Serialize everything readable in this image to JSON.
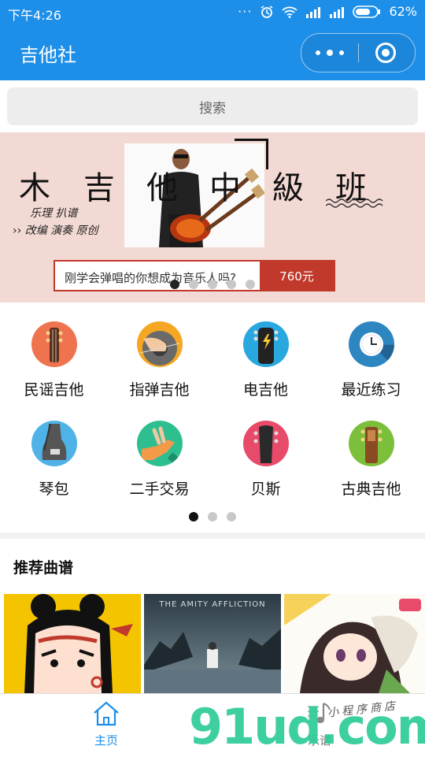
{
  "statusbar": {
    "time": "下午4:26",
    "battery": "62%"
  },
  "navbar": {
    "title": "吉他社"
  },
  "search": {
    "placeholder": "搜索"
  },
  "banner": {
    "chars": [
      "木",
      "吉",
      "他",
      "中",
      "級",
      "班"
    ],
    "sub1": "乐理  扒谱",
    "sub2": "改编  演奏  原创",
    "cta": "刚学会弹唱的你想成为音乐人吗?",
    "price": "760元",
    "dots": 5,
    "active_dot": 0
  },
  "categories": [
    {
      "label": "民谣吉他",
      "icon": "folk-guitar-icon",
      "color": "#f0734f"
    },
    {
      "label": "指弹吉他",
      "icon": "fingerstyle-guitar-icon",
      "color": "#f5a623"
    },
    {
      "label": "电吉他",
      "icon": "electric-guitar-icon",
      "color": "#29a8e0"
    },
    {
      "label": "最近练习",
      "icon": "clock-icon",
      "color": "#2e86c1"
    },
    {
      "label": "琴包",
      "icon": "guitar-bag-icon",
      "color": "#4fb3e8"
    },
    {
      "label": "二手交易",
      "icon": "trade-hand-icon",
      "color": "#2ebf91"
    },
    {
      "label": "贝斯",
      "icon": "bass-icon",
      "color": "#e84a6a"
    },
    {
      "label": "古典吉他",
      "icon": "classical-guitar-icon",
      "color": "#7cbf3a"
    }
  ],
  "category_pages": {
    "count": 3,
    "active": 0
  },
  "recommend": {
    "title": "推荐曲谱",
    "items": [
      "warrior-cartoon-cover",
      "the-amity-affliction-cover",
      "anime-girl-cover"
    ],
    "album_text": "THE AMITY AFFLICTION"
  },
  "tabbar": {
    "home": "主页",
    "score": "乐谱"
  },
  "watermark": {
    "text": "91ud.com",
    "small": "小程序商店"
  }
}
